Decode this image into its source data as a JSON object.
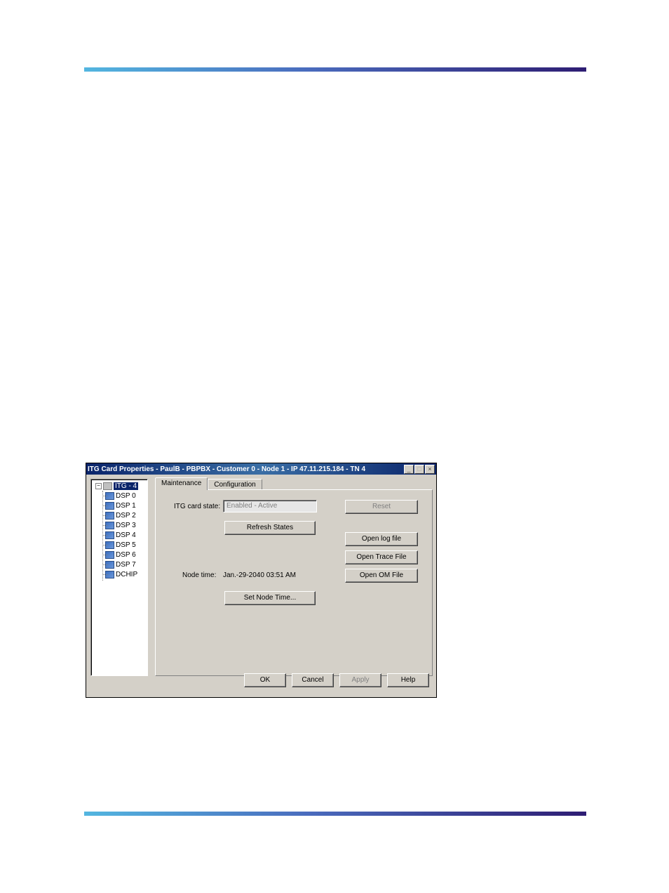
{
  "window": {
    "title": "ITG Card Properties - PaulB - PBPBX - Customer 0 - Node 1 - IP 47.11.215.184 - TN 4"
  },
  "tree": {
    "root_label": "ITG - 4",
    "children": [
      {
        "label": "DSP 0"
      },
      {
        "label": "DSP 1"
      },
      {
        "label": "DSP 2"
      },
      {
        "label": "DSP 3"
      },
      {
        "label": "DSP 4"
      },
      {
        "label": "DSP 5"
      },
      {
        "label": "DSP 6"
      },
      {
        "label": "DSP 7"
      },
      {
        "label": "DCHIP"
      }
    ]
  },
  "tabs": {
    "maintenance": "Maintenance",
    "configuration": "Configuration"
  },
  "maint": {
    "state_label": "ITG card state:",
    "state_value": "Enabled - Active",
    "refresh_btn": "Refresh States",
    "node_time_label": "Node time:",
    "node_time_value": "Jan.-29-2040 03:51 AM",
    "set_time_btn": "Set Node Time...",
    "reset_btn": "Reset",
    "open_log_btn": "Open log file",
    "open_trace_btn": "Open Trace File",
    "open_om_btn": "Open OM File"
  },
  "buttons": {
    "ok": "OK",
    "cancel": "Cancel",
    "apply": "Apply",
    "help": "Help"
  }
}
